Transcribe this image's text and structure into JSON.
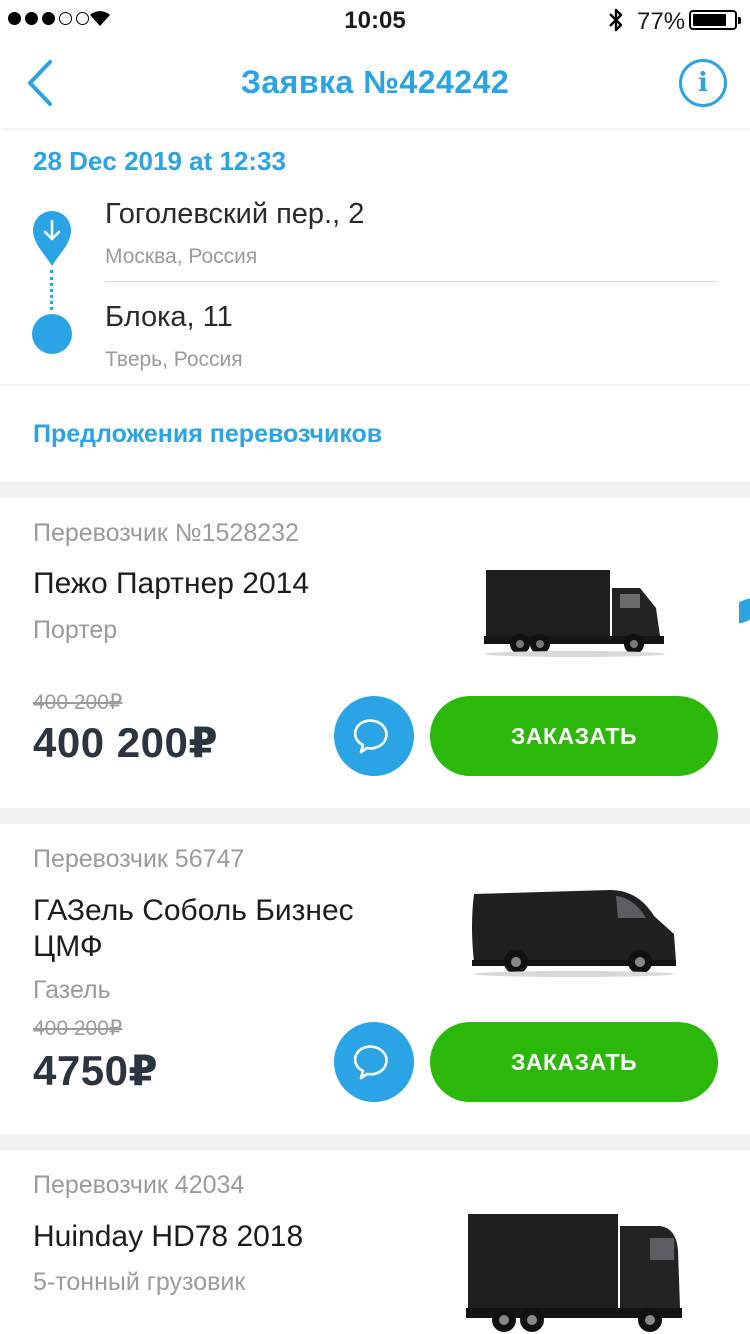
{
  "status_bar": {
    "time": "10:05",
    "battery": "77%",
    "signal_bars_filled": 3,
    "signal_bars_total": 5
  },
  "nav": {
    "title": "Заявка №424242",
    "info_label": "i"
  },
  "route": {
    "date": "28 Dec 2019 at 12:33",
    "from_address": "Гоголевский пер., 2",
    "from_city": "Москва, Россия",
    "to_address": "Блока, 11",
    "to_city": "Тверь, Россия"
  },
  "offers_title": "Предложения перевозчиков",
  "offers": [
    {
      "carrier": "Перевозчик №1528232",
      "model": "Пежо Партнер 2014",
      "type": "Портер",
      "old_price": "400 200₽",
      "price": "400 200₽",
      "order_label": "ЗАКАЗАТЬ",
      "vehicle_icon": "box-truck-icon"
    },
    {
      "carrier": "Перевозчик 56747",
      "model": "ГАЗель Соболь Бизнес ЦМФ",
      "type": "Газель",
      "old_price": "400 200₽",
      "price": "4750₽",
      "order_label": "ЗАКАЗАТЬ",
      "vehicle_icon": "van-icon"
    },
    {
      "carrier": "Перевозчик 42034",
      "model": "Huinday HD78 2018",
      "type": "5-тонный грузовик",
      "vehicle_icon": "heavy-truck-icon"
    }
  ],
  "colors": {
    "accent": "#2aa4e5",
    "order_button": "#2cb80a",
    "price_text": "#2c3440",
    "muted_text": "#9a9aa0"
  }
}
